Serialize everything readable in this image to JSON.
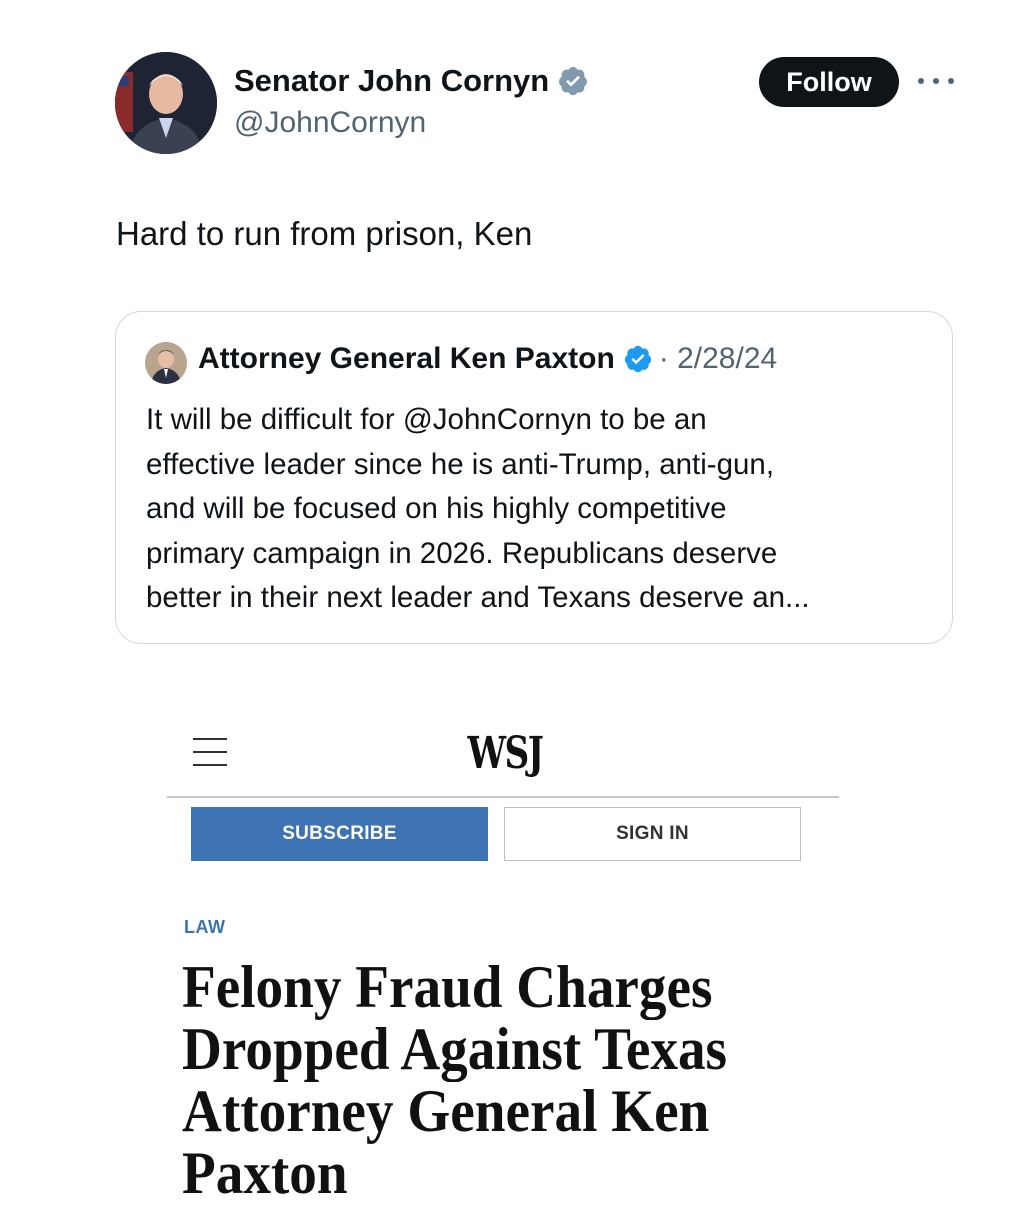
{
  "tweet": {
    "author_name": "Senator John Cornyn",
    "author_handle": "@JohnCornyn",
    "follow_label": "Follow",
    "text": "Hard to run from prison, Ken"
  },
  "quoted_tweet": {
    "author_name": "Attorney General Ken Paxton",
    "date": "· 2/28/24",
    "lines": [
      "It will be difficult for @JohnCornyn to be an",
      "effective leader since he is anti-Trump, anti-gun,",
      "and will be focused on his highly competitive",
      "primary campaign in 2026. Republicans deserve",
      "better in their next leader and Texans deserve an..."
    ]
  },
  "article": {
    "logo": "WSJ",
    "subscribe_label": "SUBSCRIBE",
    "signin_label": "SIGN IN",
    "kicker": "LAW",
    "headline_lines": [
      "Felony Fraud Charges",
      "Dropped Against Texas",
      "Attorney General Ken",
      "Paxton"
    ]
  },
  "colors": {
    "verified_blue": "#1d9bf0",
    "wsj_blue": "#3d73b2",
    "follow_button": "#0f1419"
  },
  "icons": [
    "verified-badge-icon",
    "more-options-icon",
    "hamburger-menu-icon"
  ]
}
